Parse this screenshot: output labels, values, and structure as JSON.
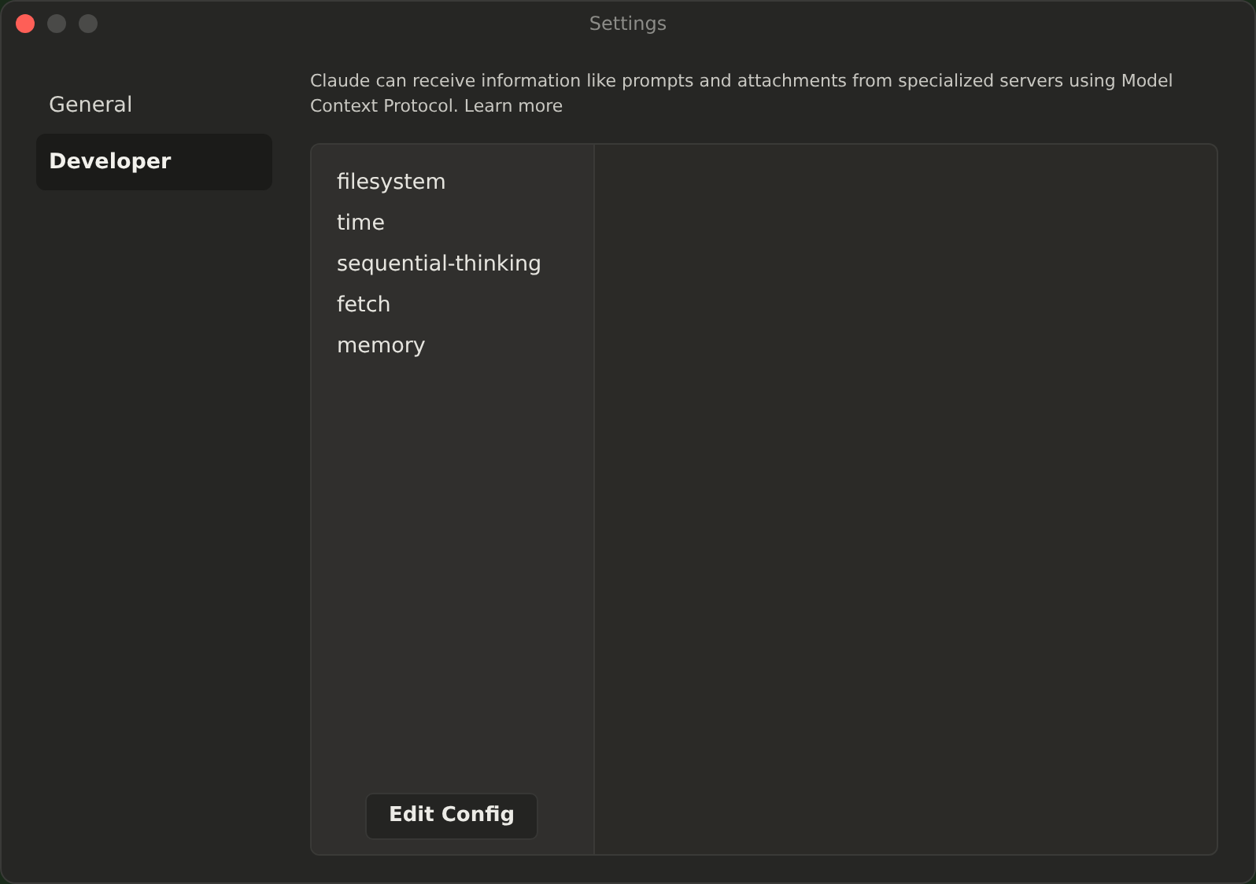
{
  "window": {
    "title": "Settings"
  },
  "sidebar": {
    "items": [
      {
        "label": "General",
        "selected": false
      },
      {
        "label": "Developer",
        "selected": true
      }
    ]
  },
  "description": {
    "text": "Claude can receive information like prompts and attachments from specialized servers using Model Context Protocol.",
    "link": "Learn more"
  },
  "servers": [
    {
      "name": "filesystem"
    },
    {
      "name": "time"
    },
    {
      "name": "sequential-thinking"
    },
    {
      "name": "fetch"
    },
    {
      "name": "memory"
    }
  ],
  "edit_button": "Edit Config"
}
